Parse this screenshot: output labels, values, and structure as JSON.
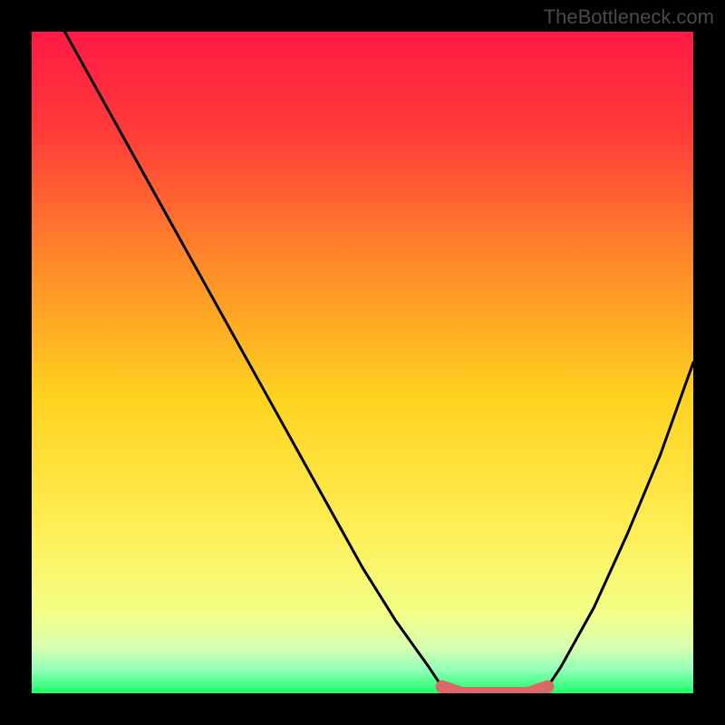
{
  "attribution": "TheBottleneck.com",
  "chart_data": {
    "type": "line",
    "title": "",
    "xlabel": "",
    "ylabel": "",
    "xlim": [
      0,
      100
    ],
    "ylim": [
      0,
      100
    ],
    "series": [
      {
        "name": "bottleneck-curve",
        "x": [
          5,
          10,
          15,
          20,
          25,
          30,
          35,
          40,
          45,
          50,
          55,
          60,
          62,
          65,
          70,
          75,
          78,
          80,
          85,
          90,
          95,
          100
        ],
        "values": [
          100,
          91,
          82,
          73,
          64,
          55,
          46,
          37,
          28,
          19,
          11,
          4,
          1,
          0,
          0,
          0,
          1,
          4,
          13,
          24,
          36,
          50
        ]
      },
      {
        "name": "optimal-region-marker",
        "x": [
          62,
          65,
          70,
          75,
          78
        ],
        "values": [
          1,
          0,
          0,
          0,
          1
        ]
      }
    ],
    "gradient_stops": [
      {
        "offset": 0.0,
        "color": "#ff1a44"
      },
      {
        "offset": 0.15,
        "color": "#ff3a3a"
      },
      {
        "offset": 0.35,
        "color": "#ff8a2a"
      },
      {
        "offset": 0.55,
        "color": "#ffd21f"
      },
      {
        "offset": 0.75,
        "color": "#ffee55"
      },
      {
        "offset": 0.88,
        "color": "#f2ff88"
      },
      {
        "offset": 0.93,
        "color": "#d8ffb0"
      },
      {
        "offset": 0.965,
        "color": "#90ffb8"
      },
      {
        "offset": 1.0,
        "color": "#1aff66"
      }
    ],
    "colors": {
      "curve": "#000000",
      "marker": "#d96868",
      "background": "#000000"
    }
  }
}
